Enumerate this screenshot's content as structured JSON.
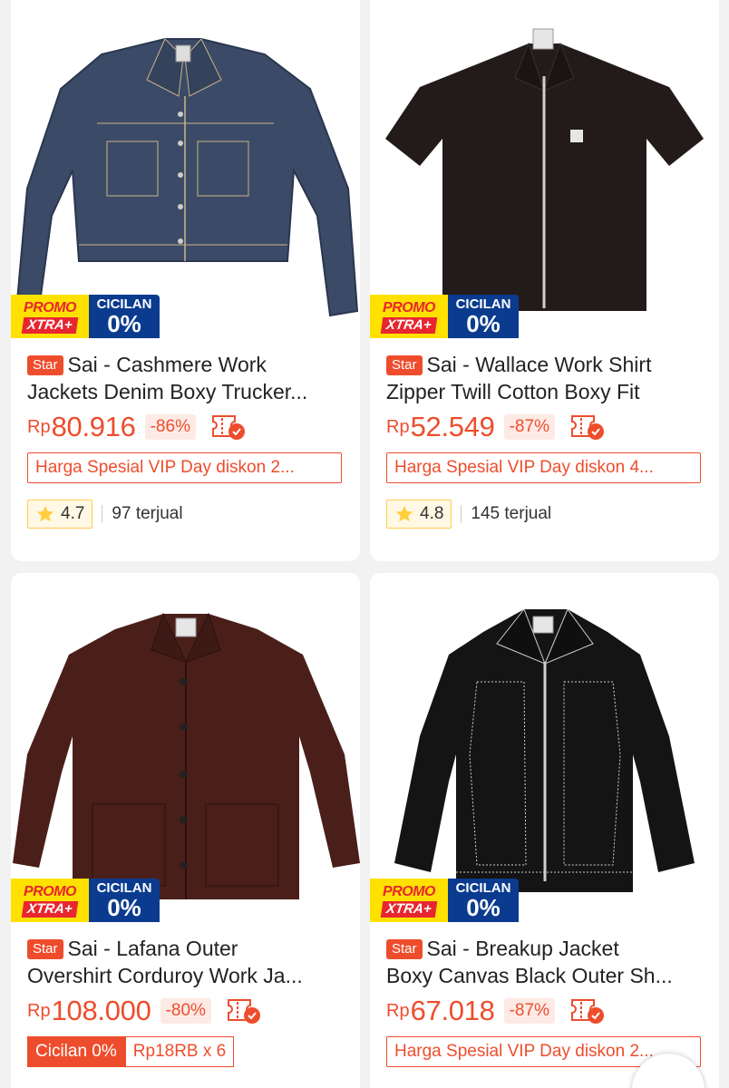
{
  "badges": {
    "promo_line1": "PROMO",
    "promo_line2": "XTRA+",
    "cicilan_line1": "CICILAN",
    "cicilan_line2": "0%"
  },
  "colors": {
    "accent": "#ee4d2d",
    "promo_yellow": "#ffe100",
    "cicilan_blue": "#0a3b8f"
  },
  "products": [
    {
      "tag": "Star",
      "title_line1": "Sai - Cashmere Work",
      "title_line2": "Jackets Denim Boxy Trucker...",
      "currency": "Rp",
      "price": "80.916",
      "discount": "-86%",
      "promo_text": "Harga Spesial VIP Day diskon 2...",
      "rating": "4.7",
      "sold": "97 terjual",
      "image": "denim-trucker-jacket"
    },
    {
      "tag": "Star",
      "title_line1": "Sai - Wallace Work Shirt",
      "title_line2": "Zipper Twill Cotton Boxy Fit",
      "currency": "Rp",
      "price": "52.549",
      "discount": "-87%",
      "promo_text": "Harga Spesial VIP Day diskon 4...",
      "rating": "4.8",
      "sold": "145 terjual",
      "image": "black-zip-work-shirt"
    },
    {
      "tag": "Star",
      "title_line1": "Sai - Lafana Outer",
      "title_line2": "Overshirt Corduroy Work Ja...",
      "currency": "Rp",
      "price": "108.000",
      "discount": "-80%",
      "cicilan_label": "Cicilan 0%",
      "cicilan_value": "Rp18RB x 6",
      "image": "brown-corduroy-overshirt"
    },
    {
      "tag": "Star",
      "title_line1": "Sai - Breakup Jacket",
      "title_line2": "Boxy Canvas Black Outer Sh...",
      "currency": "Rp",
      "price": "67.018",
      "discount": "-87%",
      "promo_text": "Harga Spesial VIP Day diskon 2...",
      "image": "black-canvas-zip-jacket"
    }
  ]
}
